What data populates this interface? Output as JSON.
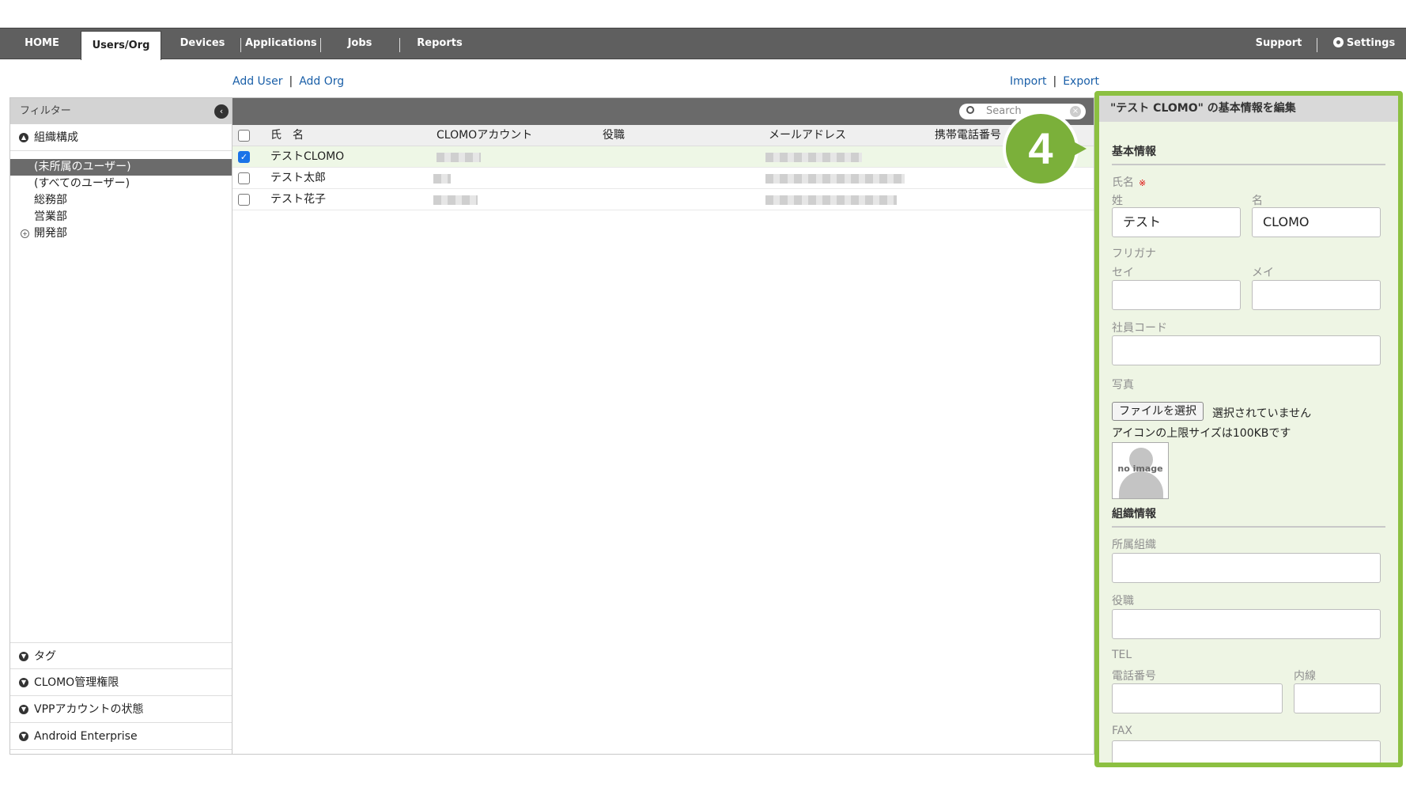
{
  "nav": {
    "home": "HOME",
    "users_org": "Users/Org",
    "devices": "Devices",
    "applications": "Applications",
    "jobs": "Jobs",
    "reports": "Reports",
    "support": "Support",
    "settings": "Settings",
    "settings_icon": "gear-icon"
  },
  "actions": {
    "add_user": "Add User",
    "add_org": "Add Org",
    "import": "Import",
    "export": "Export"
  },
  "sidebar": {
    "header": "フィルター",
    "org_section": "組織構成",
    "tree": [
      "(未所属のユーザー)",
      "(すべてのユーザー)",
      "総務部",
      "営業部",
      "開発部"
    ],
    "bottom_sections": [
      "タグ",
      "CLOMO管理権限",
      "VPPアカウントの状態",
      "Android Enterprise"
    ]
  },
  "grid": {
    "search_placeholder": "Search",
    "columns": [
      "氏　名",
      "CLOMOアカウント",
      "役職",
      "メールアドレス",
      "携帯電話番号"
    ],
    "rows": [
      {
        "name": "テストCLOMO",
        "checked": true
      },
      {
        "name": "テスト太郎",
        "checked": false
      },
      {
        "name": "テスト花子",
        "checked": false
      }
    ]
  },
  "badge": {
    "number": "4",
    "color": "#7bb03a"
  },
  "panel": {
    "title": "\"テスト CLOMO\" の基本情報を編集",
    "basic_section": "基本情報",
    "name_label": "氏名",
    "required_mark": "※",
    "sei_label": "姓",
    "mei_label": "名",
    "sei_value": "テスト",
    "mei_value": "CLOMO",
    "furigana_label": "フリガナ",
    "furigana_sei_label": "セイ",
    "furigana_mei_label": "メイ",
    "employee_code_label": "社員コード",
    "photo_label": "写真",
    "file_button": "ファイルを選択",
    "file_status": "選択されていません",
    "icon_note": "アイコンの上限サイズは100KBです",
    "no_image": "no image",
    "org_section": "組織情報",
    "affiliation_label": "所属組織",
    "position_label": "役職",
    "tel_label": "TEL",
    "phone_label": "電話番号",
    "extension_label": "内線",
    "fax_label": "FAX"
  },
  "colors": {
    "accent_green": "#8cc041",
    "link_blue": "#1a5fa8",
    "nav_bg": "#5f5f5f"
  }
}
